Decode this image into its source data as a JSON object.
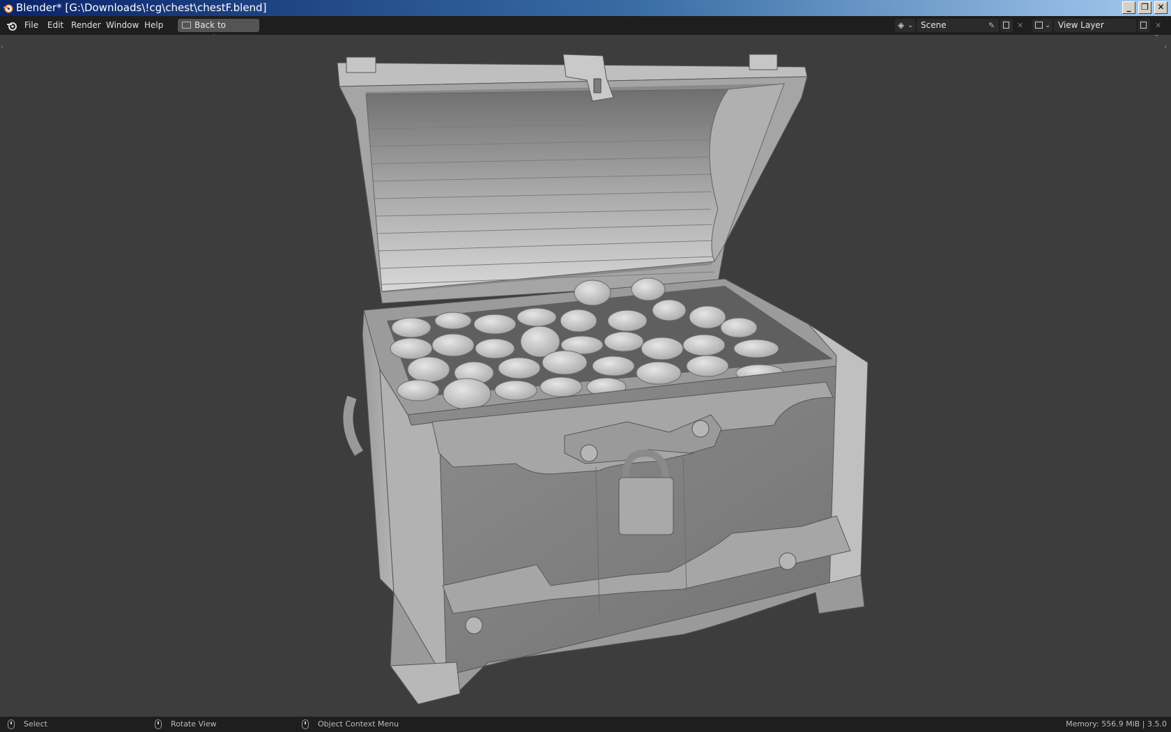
{
  "window": {
    "title": "Blender* [G:\\Downloads\\!cg\\chest\\chestF.blend]",
    "controls": {
      "minimize": "_",
      "maximize": "❐",
      "close": "✕"
    }
  },
  "menu": {
    "items": [
      "File",
      "Edit",
      "Render",
      "Window",
      "Help"
    ],
    "back_button_label": "Back to Previous"
  },
  "scene": {
    "name": "Scene",
    "view_layer": "View Layer"
  },
  "statusbar": {
    "select_label": "Select",
    "rotate_label": "Rotate View",
    "context_label": "Object Context Menu",
    "memory_text": "Memory: 556.9 MiB | 3.5.0"
  },
  "colors": {
    "background": "#3d3d3d",
    "header": "#1e1e1e",
    "title_gradient_start": "#0a246a",
    "title_gradient_end": "#a6caf0"
  },
  "icons": [
    "blender-logo-icon",
    "scene-icon",
    "pin-icon",
    "new-icon",
    "close-icon",
    "view-layer-icon",
    "mouse-left-icon",
    "mouse-middle-icon",
    "mouse-right-icon"
  ]
}
